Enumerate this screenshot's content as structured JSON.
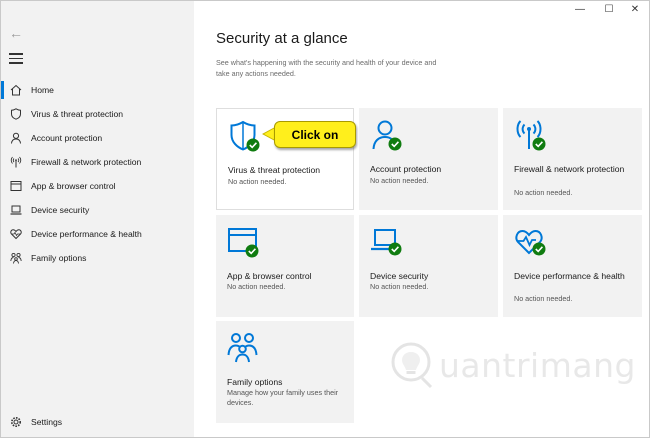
{
  "window": {
    "minimize_glyph": "—",
    "maximize_glyph": "☐",
    "close_glyph": "✕"
  },
  "sidebar": {
    "back_glyph": "←",
    "items": [
      {
        "label": "Home",
        "icon": "home-icon",
        "active": true
      },
      {
        "label": "Virus & threat protection",
        "icon": "shield-icon"
      },
      {
        "label": "Account protection",
        "icon": "person-icon"
      },
      {
        "label": "Firewall & network protection",
        "icon": "antenna-icon"
      },
      {
        "label": "App & browser control",
        "icon": "browser-window-icon"
      },
      {
        "label": "Device security",
        "icon": "laptop-icon"
      },
      {
        "label": "Device performance & health",
        "icon": "heart-icon"
      },
      {
        "label": "Family options",
        "icon": "family-icon"
      }
    ],
    "settings": {
      "label": "Settings",
      "icon": "gear-icon"
    }
  },
  "main": {
    "title": "Security at a glance",
    "subtitle": "See what's happening with the security and health of your device and take any actions needed.",
    "tiles": [
      {
        "title": "Virus & threat protection",
        "status": "No action needed.",
        "icon": "shield-check-icon"
      },
      {
        "title": "Account protection",
        "status": "No action needed.",
        "icon": "person-check-icon"
      },
      {
        "title": "Firewall & network protection",
        "status": "No action needed.",
        "icon": "antenna-check-icon"
      },
      {
        "title": "App & browser control",
        "status": "No action needed.",
        "icon": "browser-check-icon"
      },
      {
        "title": "Device security",
        "status": "No action needed.",
        "icon": "laptop-check-icon"
      },
      {
        "title": "Device performance & health",
        "status": "No action needed.",
        "icon": "heart-check-icon"
      },
      {
        "title": "Family options",
        "status": "Manage how your family uses their devices.",
        "icon": "family-icon"
      }
    ]
  },
  "callout": {
    "text": "Click on"
  },
  "watermark": {
    "text": "uantrimang"
  },
  "colors": {
    "accent": "#0078d7",
    "ok": "#107c10",
    "callout": "#ffef1c",
    "sidebar_bg": "#f2f2f2",
    "tile_bg": "#f2f2f2"
  }
}
